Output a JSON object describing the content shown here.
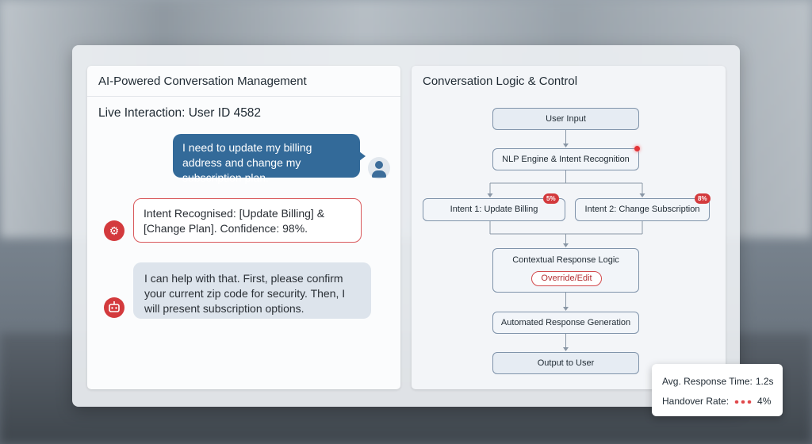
{
  "left_panel": {
    "title": "AI-Powered Conversation Management",
    "live_title": "Live Interaction: User ID 4582",
    "messages": {
      "user": "I need to update my billing address and change my subscription plan.",
      "intent": "Intent Recognised: [Update Billing] & [Change Plan]. Confidence: 98%.",
      "bot": "I can help with that. First, please confirm your current zip code for security. Then, I will present subscription options."
    }
  },
  "right_panel": {
    "title": "Conversation Logic & Control",
    "nodes": {
      "user_input": "User Input",
      "nlp": "NLP Engine & Intent Recognition",
      "intent1": "Intent 1: Update Billing",
      "intent2": "Intent 2: Change Subscription",
      "contextual": "Contextual Response Logic",
      "override": "Override/Edit",
      "automated": "Automated Response Generation",
      "output": "Output to User"
    },
    "badges": {
      "intent1": "5%",
      "intent2": "8%"
    }
  },
  "metrics": {
    "response_label": "Avg. Response Time:",
    "response_value": "1.2s",
    "handover_label": "Handover Rate:",
    "handover_value": "4%"
  },
  "icons": {
    "user_avatar": "user-avatar-icon",
    "intent": "gear-target-icon",
    "bot": "robot-icon"
  },
  "colors": {
    "accent_blue": "#336a99",
    "accent_red": "#d33a3d",
    "node_fill": "#e6ecf3"
  }
}
